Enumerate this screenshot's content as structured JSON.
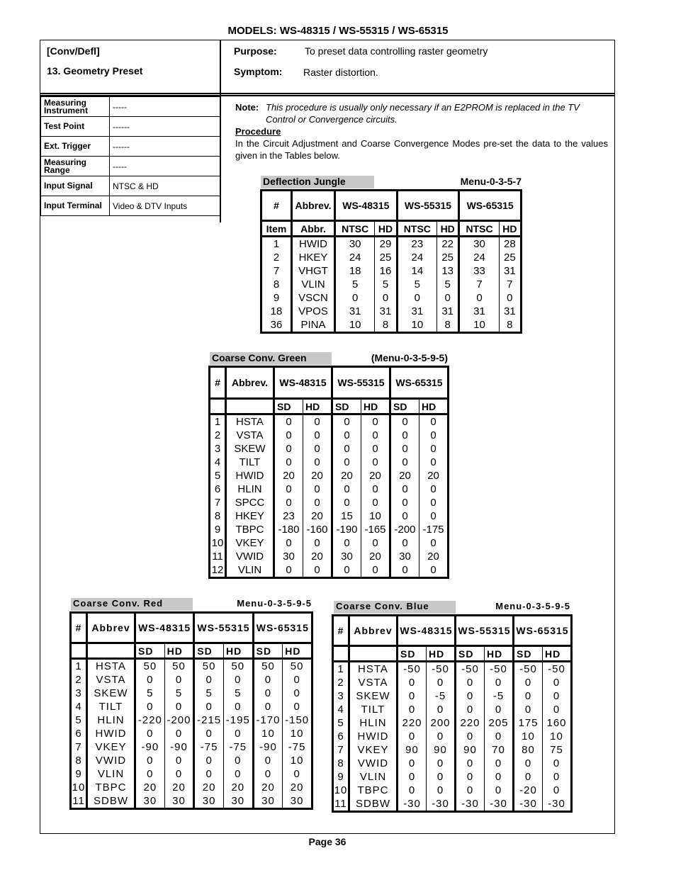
{
  "header": {
    "models": "MODELS: WS-48315 / WS-55315 / WS-65315",
    "section": "[Conv/Defl]",
    "title": "13. Geometry Preset",
    "purpose_label": "Purpose:",
    "purpose": "To preset data controlling raster geometry",
    "symptom_label": "Symptom:",
    "symptom": "Raster distortion."
  },
  "spec": [
    {
      "label": "Measuring Instrument",
      "value": "-----"
    },
    {
      "label": "Test Point",
      "value": "------"
    },
    {
      "label": "Ext. Trigger",
      "value": "------"
    },
    {
      "label": "Measuring Range",
      "value": "-----"
    },
    {
      "label": "Input Signal",
      "value": "NTSC & HD"
    },
    {
      "label": "Input Terminal",
      "value": "Video & DTV Inputs"
    }
  ],
  "note": {
    "label": "Note:",
    "text": "This procedure is usually only necessary if an E2PROM is replaced in the TV Control or Convergence circuits.",
    "procedure_heading": "Procedure",
    "procedure_text": "In the Circuit Adjustment and Coarse Convergence Modes pre-set the data to the values given in the Tables below."
  },
  "deflection": {
    "caption": "Deflection Jungle",
    "menu": "Menu-0-3-5-7",
    "h_num": "#",
    "h_abbrev": "Abbrev.",
    "models": [
      "WS-48315",
      "WS-55315",
      "WS-65315"
    ],
    "h_item": "Item",
    "h_abbr": "Abbr.",
    "sub": [
      "NTSC",
      "HD",
      "NTSC",
      "HD",
      "NTSC",
      "HD"
    ],
    "rows": [
      {
        "n": "1",
        "a": "HWID",
        "v": [
          "30",
          "29",
          "23",
          "22",
          "30",
          "28"
        ]
      },
      {
        "n": "2",
        "a": "HKEY",
        "v": [
          "24",
          "25",
          "24",
          "25",
          "24",
          "25"
        ]
      },
      {
        "n": "7",
        "a": "VHGT",
        "v": [
          "18",
          "16",
          "14",
          "13",
          "33",
          "31"
        ]
      },
      {
        "n": "8",
        "a": "VLIN",
        "v": [
          "5",
          "5",
          "5",
          "5",
          "7",
          "7"
        ]
      },
      {
        "n": "9",
        "a": "VSCN",
        "v": [
          "0",
          "0",
          "0",
          "0",
          "0",
          "0"
        ]
      },
      {
        "n": "18",
        "a": "VPOS",
        "v": [
          "31",
          "31",
          "31",
          "31",
          "31",
          "31"
        ]
      },
      {
        "n": "36",
        "a": "PINA",
        "v": [
          "10",
          "8",
          "10",
          "8",
          "10",
          "8"
        ]
      }
    ]
  },
  "green": {
    "caption": "Coarse Conv. Green",
    "menu": "(Menu-0-3-5-9-5)",
    "h_num": "#",
    "h_abbrev": "Abbrev.",
    "models": [
      "WS-48315",
      "WS-55315",
      "WS-65315"
    ],
    "sub": [
      "SD",
      "HD",
      "SD",
      "HD",
      "SD",
      "HD"
    ],
    "rows": [
      {
        "n": "1",
        "a": "HSTA",
        "v": [
          "0",
          "0",
          "0",
          "0",
          "0",
          "0"
        ]
      },
      {
        "n": "2",
        "a": "VSTA",
        "v": [
          "0",
          "0",
          "0",
          "0",
          "0",
          "0"
        ]
      },
      {
        "n": "3",
        "a": "SKEW",
        "v": [
          "0",
          "0",
          "0",
          "0",
          "0",
          "0"
        ]
      },
      {
        "n": "4",
        "a": "TILT",
        "v": [
          "0",
          "0",
          "0",
          "0",
          "0",
          "0"
        ]
      },
      {
        "n": "5",
        "a": "HWID",
        "v": [
          "20",
          "20",
          "20",
          "20",
          "20",
          "20"
        ]
      },
      {
        "n": "6",
        "a": "HLIN",
        "v": [
          "0",
          "0",
          "0",
          "0",
          "0",
          "0"
        ]
      },
      {
        "n": "7",
        "a": "SPCC",
        "v": [
          "0",
          "0",
          "0",
          "0",
          "0",
          "0"
        ]
      },
      {
        "n": "8",
        "a": "HKEY",
        "v": [
          "23",
          "20",
          "15",
          "10",
          "0",
          "0"
        ]
      },
      {
        "n": "9",
        "a": "TBPC",
        "v": [
          "-180",
          "-160",
          "-190",
          "-165",
          "-200",
          "-175"
        ]
      },
      {
        "n": "10",
        "a": "VKEY",
        "v": [
          "0",
          "0",
          "0",
          "0",
          "0",
          "0"
        ]
      },
      {
        "n": "11",
        "a": "VWID",
        "v": [
          "30",
          "20",
          "30",
          "20",
          "30",
          "20"
        ]
      },
      {
        "n": "12",
        "a": "VLIN",
        "v": [
          "0",
          "0",
          "0",
          "0",
          "0",
          "0"
        ]
      }
    ]
  },
  "red": {
    "caption": "Coarse Conv. Red",
    "menu": "Menu-0-3-5-9-5",
    "h_num": "#",
    "h_abbrev": "Abbrev",
    "models": [
      "WS-48315",
      "WS-55315",
      "WS-65315"
    ],
    "sub": [
      "SD",
      "HD",
      "SD",
      "HD",
      "SD",
      "HD"
    ],
    "rows": [
      {
        "n": "1",
        "a": "HSTA",
        "v": [
          "50",
          "50",
          "50",
          "50",
          "50",
          "50"
        ]
      },
      {
        "n": "2",
        "a": "VSTA",
        "v": [
          "0",
          "0",
          "0",
          "0",
          "0",
          "0"
        ]
      },
      {
        "n": "3",
        "a": "SKEW",
        "v": [
          "5",
          "5",
          "5",
          "5",
          "0",
          "0"
        ]
      },
      {
        "n": "4",
        "a": "TILT",
        "v": [
          "0",
          "0",
          "0",
          "0",
          "0",
          "0"
        ]
      },
      {
        "n": "5",
        "a": "HLIN",
        "v": [
          "-220",
          "-200",
          "-215",
          "-195",
          "-170",
          "-150"
        ]
      },
      {
        "n": "6",
        "a": "HWID",
        "v": [
          "0",
          "0",
          "0",
          "0",
          "10",
          "10"
        ]
      },
      {
        "n": "7",
        "a": "VKEY",
        "v": [
          "-90",
          "-90",
          "-75",
          "-75",
          "-90",
          "-75"
        ]
      },
      {
        "n": "8",
        "a": "VWID",
        "v": [
          "0",
          "0",
          "0",
          "0",
          "0",
          "10"
        ]
      },
      {
        "n": "9",
        "a": "VLIN",
        "v": [
          "0",
          "0",
          "0",
          "0",
          "0",
          "0"
        ]
      },
      {
        "n": "10",
        "a": "TBPC",
        "v": [
          "20",
          "20",
          "20",
          "20",
          "20",
          "20"
        ]
      },
      {
        "n": "11",
        "a": "SDBW",
        "v": [
          "30",
          "30",
          "30",
          "30",
          "30",
          "30"
        ]
      }
    ]
  },
  "blue": {
    "caption": "Coarse Conv. Blue",
    "menu": "Menu-0-3-5-9-5",
    "h_num": "#",
    "h_abbrev": "Abbrev",
    "models": [
      "WS-48315",
      "WS-55315",
      "WS-65315"
    ],
    "sub": [
      "SD",
      "HD",
      "SD",
      "HD",
      "SD",
      "HD"
    ],
    "rows": [
      {
        "n": "1",
        "a": "HSTA",
        "v": [
          "-50",
          "-50",
          "-50",
          "-50",
          "-50",
          "-50"
        ]
      },
      {
        "n": "2",
        "a": "VSTA",
        "v": [
          "0",
          "0",
          "0",
          "0",
          "0",
          "0"
        ]
      },
      {
        "n": "3",
        "a": "SKEW",
        "v": [
          "0",
          "-5",
          "0",
          "-5",
          "0",
          "0"
        ]
      },
      {
        "n": "4",
        "a": "TILT",
        "v": [
          "0",
          "0",
          "0",
          "0",
          "0",
          "0"
        ]
      },
      {
        "n": "5",
        "a": "HLIN",
        "v": [
          "220",
          "200",
          "220",
          "205",
          "175",
          "160"
        ]
      },
      {
        "n": "6",
        "a": "HWID",
        "v": [
          "0",
          "0",
          "0",
          "0",
          "10",
          "10"
        ]
      },
      {
        "n": "7",
        "a": "VKEY",
        "v": [
          "90",
          "90",
          "90",
          "70",
          "80",
          "75"
        ]
      },
      {
        "n": "8",
        "a": "VWID",
        "v": [
          "0",
          "0",
          "0",
          "0",
          "0",
          "0"
        ]
      },
      {
        "n": "9",
        "a": "VLIN",
        "v": [
          "0",
          "0",
          "0",
          "0",
          "0",
          "0"
        ]
      },
      {
        "n": "10",
        "a": "TBPC",
        "v": [
          "0",
          "0",
          "0",
          "0",
          "-20",
          "0"
        ]
      },
      {
        "n": "11",
        "a": "SDBW",
        "v": [
          "-30",
          "-30",
          "-30",
          "-30",
          "-30",
          "-30"
        ]
      }
    ]
  },
  "footer": {
    "page": "Page 36"
  }
}
